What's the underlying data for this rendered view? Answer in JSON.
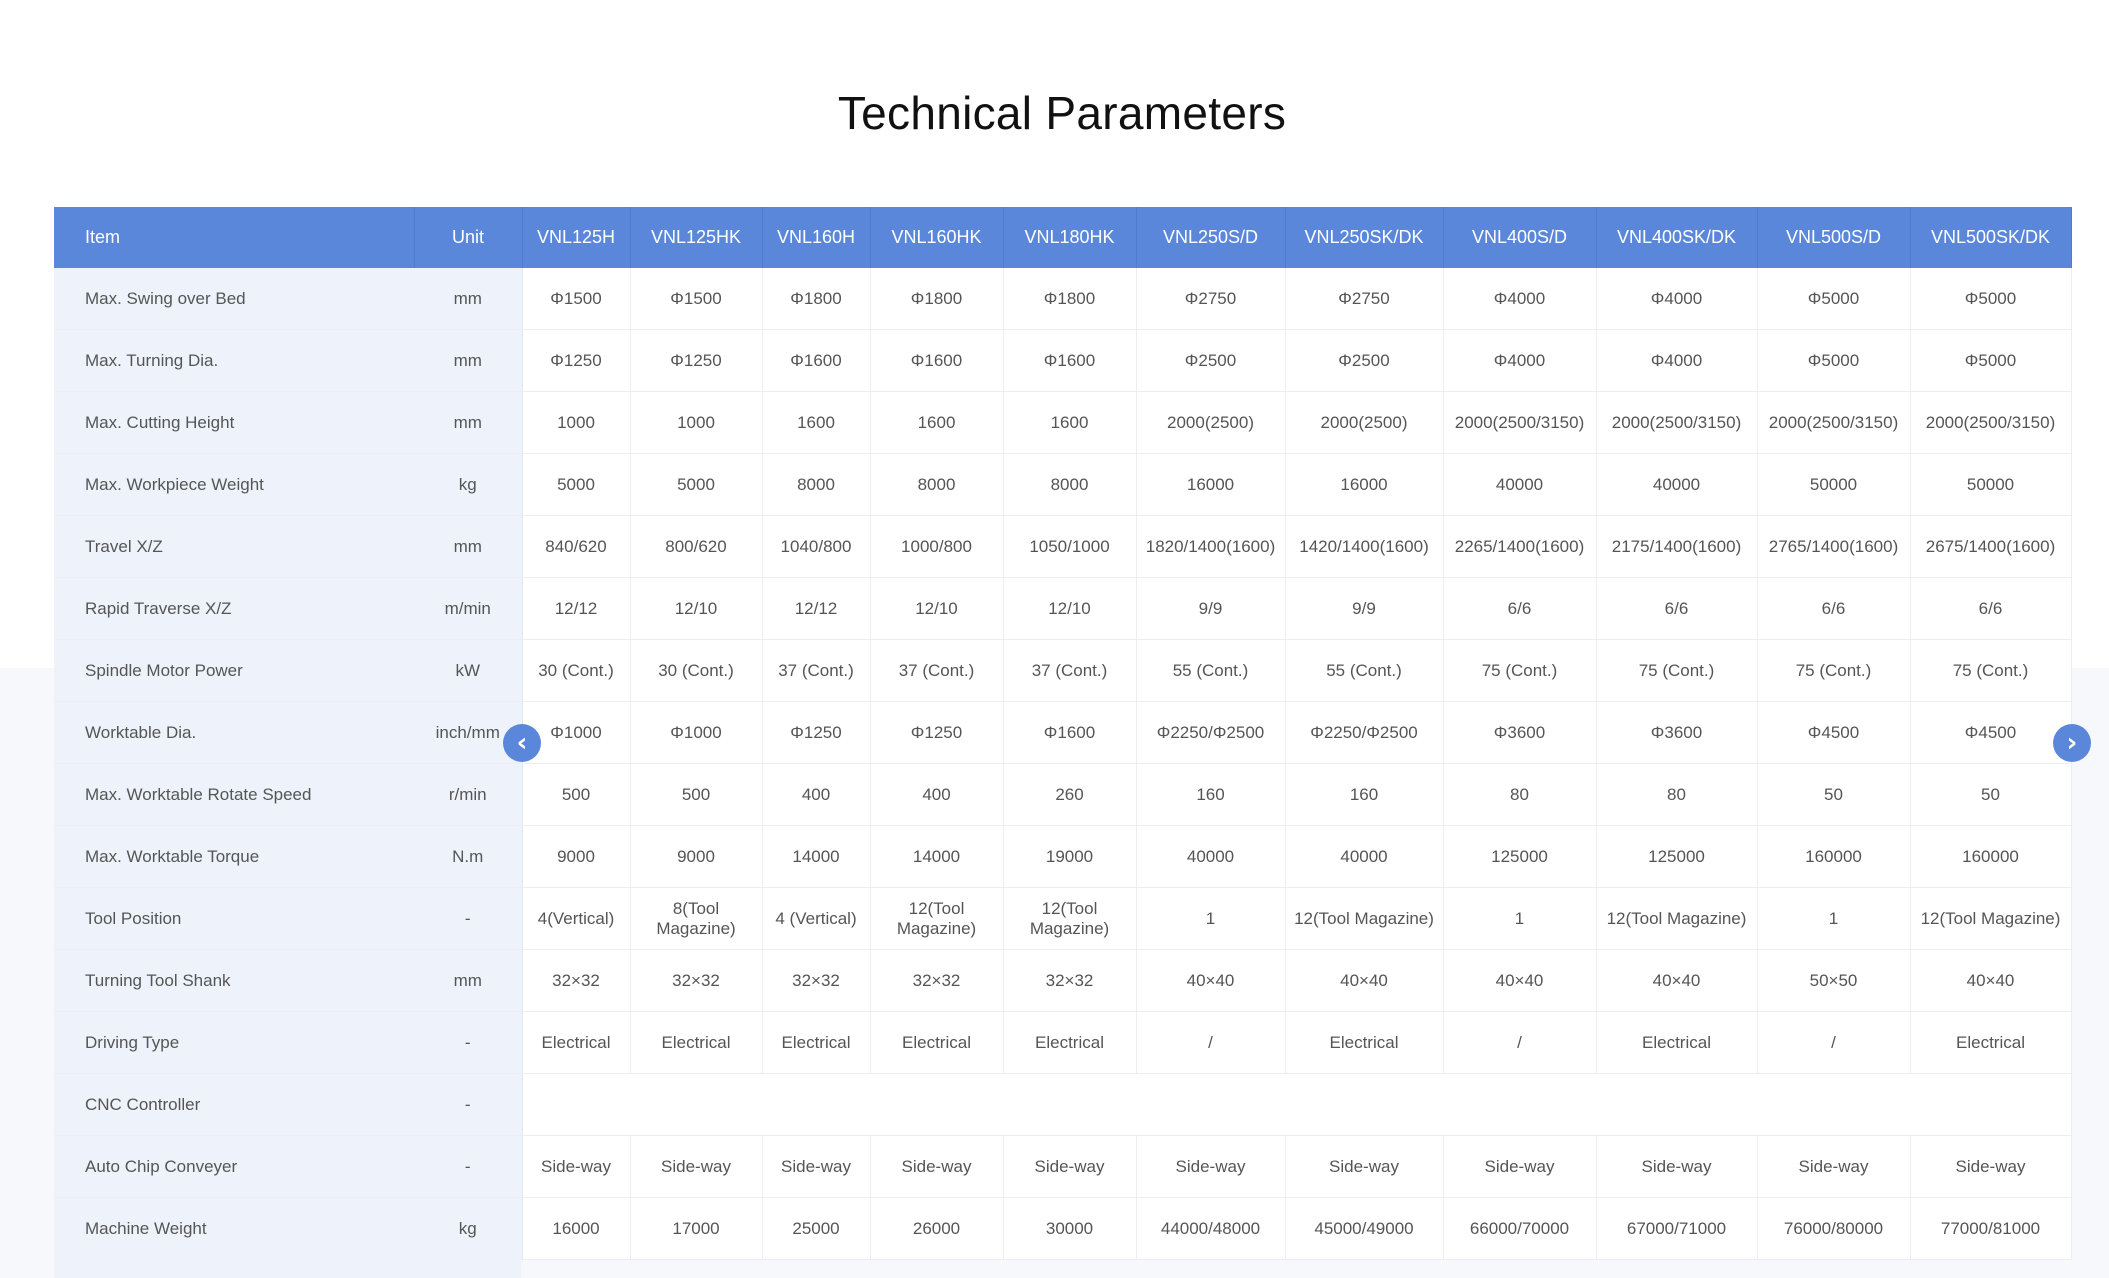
{
  "title": "Technical Parameters",
  "header": [
    "Item",
    "Unit",
    "VNL125H",
    "VNL125HK",
    "VNL160H",
    "VNL160HK",
    "VNL180HK",
    "VNL250S/D",
    "VNL250SK/DK",
    "VNL400S/D",
    "VNL400SK/DK",
    "VNL500S/D",
    "VNL500SK/DK"
  ],
  "rows": [
    {
      "item": "Max. Swing over Bed",
      "unit": "mm",
      "values": [
        "Φ1500",
        "Φ1500",
        "Φ1800",
        "Φ1800",
        "Φ1800",
        "Φ2750",
        "Φ2750",
        "Φ4000",
        "Φ4000",
        "Φ5000",
        "Φ5000"
      ]
    },
    {
      "item": "Max. Turning Dia.",
      "unit": "mm",
      "values": [
        "Φ1250",
        "Φ1250",
        "Φ1600",
        "Φ1600",
        "Φ1600",
        "Φ2500",
        "Φ2500",
        "Φ4000",
        "Φ4000",
        "Φ5000",
        "Φ5000"
      ]
    },
    {
      "item": "Max. Cutting Height",
      "unit": "mm",
      "values": [
        "1000",
        "1000",
        "1600",
        "1600",
        "1600",
        "2000(2500)",
        "2000(2500)",
        "2000(2500/3150)",
        "2000(2500/3150)",
        "2000(2500/3150)",
        "2000(2500/3150)"
      ]
    },
    {
      "item": "Max. Workpiece Weight",
      "unit": "kg",
      "values": [
        "5000",
        "5000",
        "8000",
        "8000",
        "8000",
        "16000",
        "16000",
        "40000",
        "40000",
        "50000",
        "50000"
      ]
    },
    {
      "item": "Travel X/Z",
      "unit": "mm",
      "values": [
        "840/620",
        "800/620",
        "1040/800",
        "1000/800",
        "1050/1000",
        "1820/1400(1600)",
        "1420/1400(1600)",
        "2265/1400(1600)",
        "2175/1400(1600)",
        "2765/1400(1600)",
        "2675/1400(1600)"
      ]
    },
    {
      "item": "Rapid Traverse X/Z",
      "unit": "m/min",
      "values": [
        "12/12",
        "12/10",
        "12/12",
        "12/10",
        "12/10",
        "9/9",
        "9/9",
        "6/6",
        "6/6",
        "6/6",
        "6/6"
      ]
    },
    {
      "item": "Spindle Motor Power",
      "unit": "kW",
      "values": [
        "30 (Cont.)",
        "30 (Cont.)",
        "37 (Cont.)",
        "37 (Cont.)",
        "37 (Cont.)",
        "55 (Cont.)",
        "55 (Cont.)",
        "75 (Cont.)",
        "75 (Cont.)",
        "75 (Cont.)",
        "75 (Cont.)"
      ]
    },
    {
      "item": "Worktable Dia.",
      "unit": "inch/mm",
      "values": [
        "Φ1000",
        "Φ1000",
        "Φ1250",
        "Φ1250",
        "Φ1600",
        "Φ2250/Φ2500",
        "Φ2250/Φ2500",
        "Φ3600",
        "Φ3600",
        "Φ4500",
        "Φ4500"
      ]
    },
    {
      "item": "Max. Worktable Rotate Speed",
      "unit": "r/min",
      "values": [
        "500",
        "500",
        "400",
        "400",
        "260",
        "160",
        "160",
        "80",
        "80",
        "50",
        "50"
      ]
    },
    {
      "item": "Max. Worktable Torque",
      "unit": "N.m",
      "values": [
        "9000",
        "9000",
        "14000",
        "14000",
        "19000",
        "40000",
        "40000",
        "125000",
        "125000",
        "160000",
        "160000"
      ]
    },
    {
      "item": "Tool Position",
      "unit": "-",
      "values": [
        "4(Vertical)",
        "8(Tool Magazine)",
        "4 (Vertical)",
        "12(Tool Magazine)",
        "12(Tool Magazine)",
        "1",
        "12(Tool Magazine)",
        "1",
        "12(Tool Magazine)",
        "1",
        "12(Tool Magazine)"
      ]
    },
    {
      "item": "Turning Tool Shank",
      "unit": "mm",
      "values": [
        "32×32",
        "32×32",
        "32×32",
        "32×32",
        "32×32",
        "40×40",
        "40×40",
        "40×40",
        "40×40",
        "50×50",
        "40×40"
      ]
    },
    {
      "item": "Driving Type",
      "unit": "-",
      "values": [
        "Electrical",
        "Electrical",
        "Electrical",
        "Electrical",
        "Electrical",
        "/",
        "Electrical",
        "/",
        "Electrical",
        "/",
        "Electrical"
      ]
    },
    {
      "item": "CNC Controller",
      "unit": "-",
      "values": []
    },
    {
      "item": "Auto Chip Conveyer",
      "unit": "-",
      "values": [
        "Side-way",
        "Side-way",
        "Side-way",
        "Side-way",
        "Side-way",
        "Side-way",
        "Side-way",
        "Side-way",
        "Side-way",
        "Side-way",
        "Side-way"
      ]
    },
    {
      "item": "Machine Weight",
      "unit": "kg",
      "values": [
        "16000",
        "17000",
        "25000",
        "26000",
        "30000",
        "44000/48000",
        "45000/49000",
        "66000/70000",
        "67000/71000",
        "76000/80000",
        "77000/81000"
      ]
    }
  ],
  "nav": {
    "prev_icon": "chevron-left-icon",
    "next_icon": "chevron-right-icon",
    "prev_glyph": "‹",
    "next_glyph": "›"
  },
  "colors": {
    "header_bg": "#5b87db",
    "label_bg": "#eef3fb",
    "button_bg": "#5b87db"
  }
}
